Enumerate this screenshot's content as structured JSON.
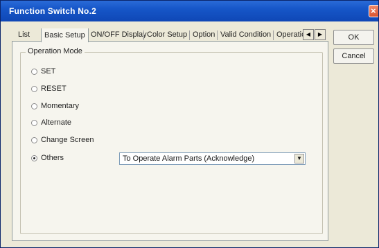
{
  "window": {
    "title": "Function Switch No.2"
  },
  "tabs": [
    {
      "label": "List",
      "active": false
    },
    {
      "label": "Basic Setup",
      "active": true
    },
    {
      "label": "ON/OFF Display",
      "active": false
    },
    {
      "label": "Color Setup",
      "active": false
    },
    {
      "label": "Option",
      "active": false
    },
    {
      "label": "Valid Condition",
      "active": false
    },
    {
      "label": "Operatior",
      "active": false
    }
  ],
  "tab_scroll": {
    "left": "◀",
    "right": "▶"
  },
  "group": {
    "label": "Operation Mode"
  },
  "modes": [
    {
      "label": "SET",
      "selected": false
    },
    {
      "label": "RESET",
      "selected": false
    },
    {
      "label": "Momentary",
      "selected": false
    },
    {
      "label": "Alternate",
      "selected": false
    },
    {
      "label": "Change Screen",
      "selected": false
    },
    {
      "label": "Others",
      "selected": true
    }
  ],
  "others_select": {
    "value": "To Operate Alarm Parts (Acknowledge)",
    "arrow": "▼"
  },
  "buttons": {
    "ok": "OK",
    "cancel": "Cancel"
  },
  "icons": {
    "close": "close-icon"
  }
}
